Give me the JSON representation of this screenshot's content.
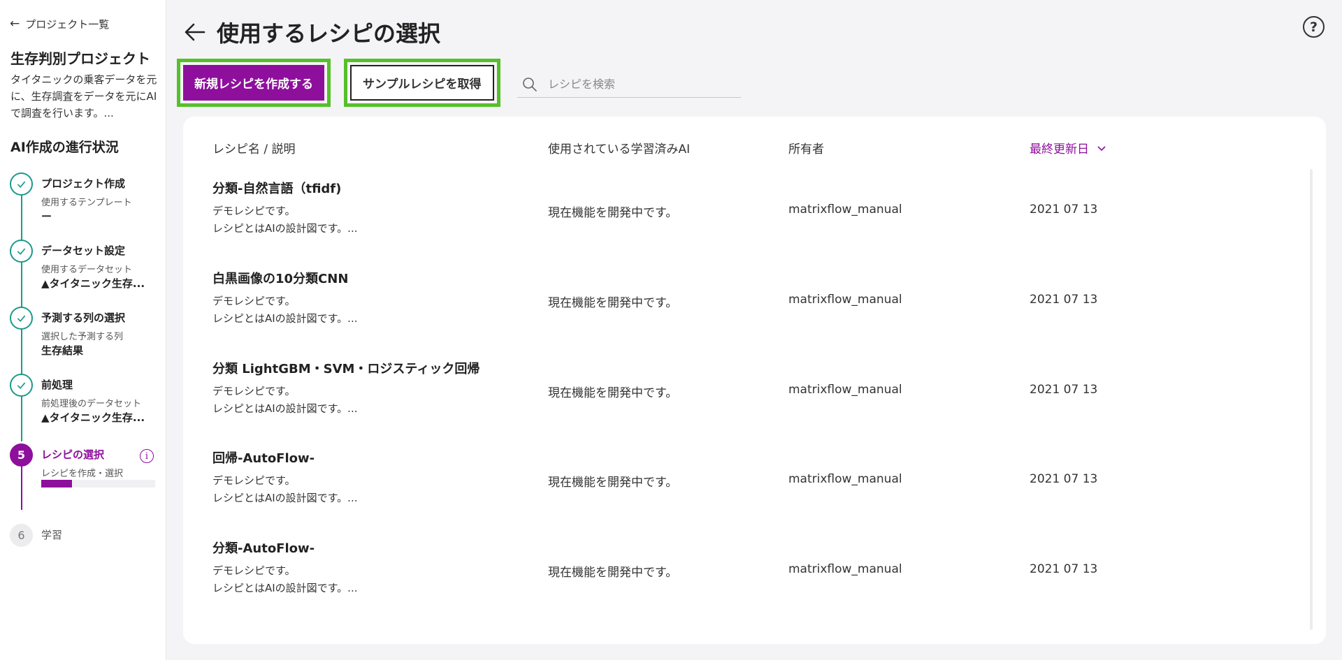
{
  "sidebar": {
    "back_label": "プロジェクト一覧",
    "project_title": "生存判別プロジェクト",
    "project_desc": "タイタニックの乗客データを元に、生存調査をデータを元にAIで調査を行います。...",
    "progress_title": "AI作成の進行状況",
    "steps": [
      {
        "title": "プロジェクト作成",
        "sub": "使用するテンプレート",
        "value": "ー",
        "status": "done"
      },
      {
        "title": "データセット設定",
        "sub": "使用するデータセット",
        "value": "▲タイタニック生存...",
        "status": "done"
      },
      {
        "title": "予測する列の選択",
        "sub": "選択した予測する列",
        "value": "生存結果",
        "status": "done"
      },
      {
        "title": "前処理",
        "sub": "前処理後のデータセット",
        "value": "▲タイタニック生存...",
        "status": "done"
      },
      {
        "number": "5",
        "title": "レシピの選択",
        "sub": "レシピを作成・選択",
        "status": "active",
        "progress": 0.27
      },
      {
        "number": "6",
        "title": "学習",
        "status": "pending"
      }
    ]
  },
  "header": {
    "title": "使用するレシピの選択"
  },
  "toolbar": {
    "new_recipe_label": "新規レシピを作成する",
    "sample_recipe_label": "サンプルレシピを取得",
    "search_placeholder": "レシピを検索"
  },
  "table": {
    "columns": [
      "レシピ名 / 説明",
      "使用されている学習済みAI",
      "所有者",
      "最終更新日"
    ],
    "rows": [
      {
        "name": "分類-自然言語（tfidf)",
        "desc": "デモレシピです。\nレシピとはAIの設計図です。...",
        "ai": "現在機能を開発中です。",
        "owner": "matrixflow_manual",
        "date": "2021 07 13"
      },
      {
        "name": "白黒画像の10分類CNN",
        "desc": "デモレシピです。\nレシピとはAIの設計図です。...",
        "ai": "現在機能を開発中です。",
        "owner": "matrixflow_manual",
        "date": "2021 07 13"
      },
      {
        "name": "分類 LightGBM・SVM・ロジスティック回帰",
        "desc": "デモレシピです。\nレシピとはAIの設計図です。...",
        "ai": "現在機能を開発中です。",
        "owner": "matrixflow_manual",
        "date": "2021 07 13"
      },
      {
        "name": "回帰-AutoFlow-",
        "desc": "デモレシピです。\nレシピとはAIの設計図です。...",
        "ai": "現在機能を開発中です。",
        "owner": "matrixflow_manual",
        "date": "2021 07 13"
      },
      {
        "name": "分類-AutoFlow-",
        "desc": "デモレシピです。\nレシピとはAIの設計図です。...",
        "ai": "現在機能を開発中です。",
        "owner": "matrixflow_manual",
        "date": "2021 07 13"
      }
    ]
  },
  "colors": {
    "accent": "#8e0f9c",
    "step_done": "#1a9a8c",
    "highlight": "#55c02a"
  },
  "icons": [
    "arrow-left-icon",
    "help-icon",
    "search-icon",
    "check-icon",
    "info-icon",
    "chevron-down-icon"
  ]
}
